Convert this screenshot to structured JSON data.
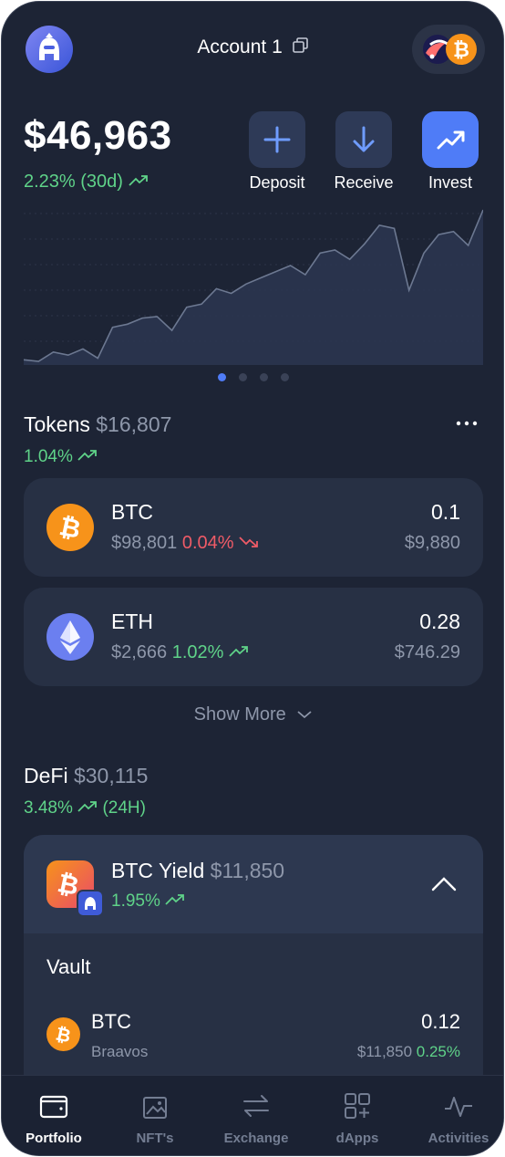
{
  "header": {
    "account_label": "Account 1"
  },
  "balance": {
    "amount": "$46,963",
    "change": "2.23% (30d)"
  },
  "actions": {
    "deposit": "Deposit",
    "receive": "Receive",
    "invest": "Invest"
  },
  "chart_data": {
    "type": "area",
    "values": [
      3,
      2,
      8,
      6,
      10,
      4,
      24,
      26,
      30,
      31,
      22,
      37,
      39,
      49,
      46,
      52,
      56,
      60,
      64,
      58,
      72,
      74,
      68,
      78,
      90,
      88,
      48,
      72,
      84,
      86,
      77,
      100
    ],
    "pages": 4,
    "active_page": 0
  },
  "tokens": {
    "title": "Tokens",
    "total": "$16,807",
    "change": "1.04%",
    "items": [
      {
        "symbol": "BTC",
        "price": "$98,801",
        "change": "0.04%",
        "direction": "down",
        "amount": "0.1",
        "value": "$9,880"
      },
      {
        "symbol": "ETH",
        "price": "$2,666",
        "change": "1.02%",
        "direction": "up",
        "amount": "0.28",
        "value": "$746.29"
      }
    ],
    "show_more": "Show More"
  },
  "defi": {
    "title": "DeFi",
    "total": "$30,115",
    "change": "3.48%",
    "period": "(24H)",
    "position": {
      "name": "BTC Yield",
      "value": "$11,850",
      "change": "1.95%"
    },
    "vault_label": "Vault",
    "vault_item": {
      "symbol": "BTC",
      "provider": "Braavos",
      "amount": "0.12",
      "value": "$11,850",
      "change": "0.25%"
    }
  },
  "nav": {
    "portfolio": "Portfolio",
    "nfts": "NFT's",
    "exchange": "Exchange",
    "dapps": "dApps",
    "activities": "Activities"
  },
  "colors": {
    "background": "#1d2435",
    "card": "#273044",
    "accent": "#4f7cf7",
    "positive": "#5fd389",
    "negative": "#ef5b67"
  }
}
